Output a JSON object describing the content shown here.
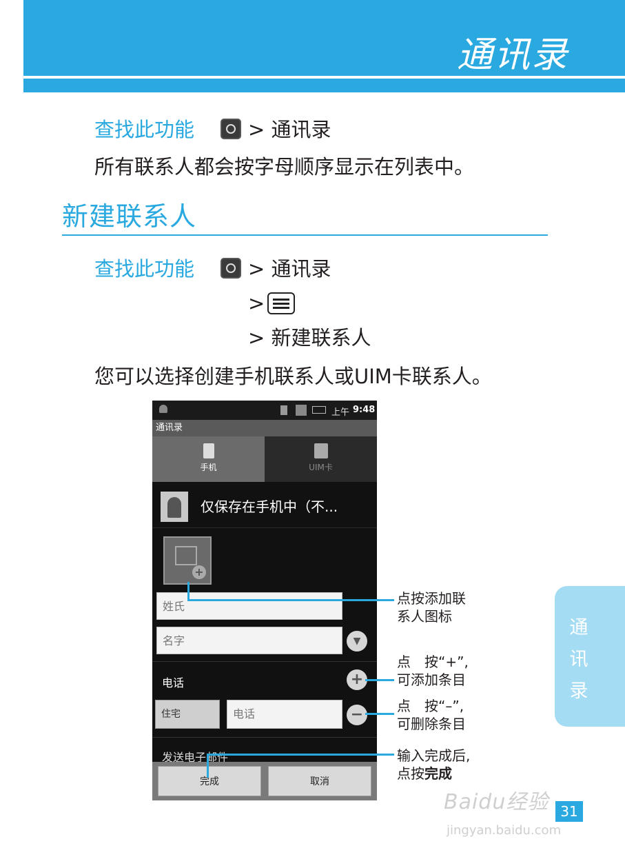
{
  "header": {
    "title": "通讯录"
  },
  "block1": {
    "find_label": "查找此功能",
    "path": "> 通讯录",
    "body": "所有联系人都会按字母顺序显示在列表中。"
  },
  "section": {
    "title": "新建联系人"
  },
  "block2": {
    "find_label": "查找此功能",
    "path1": "> 通讯录",
    "path2": ">",
    "path3": "> 新建联系人",
    "body": "您可以选择创建手机联系人或UIM卡联系人。"
  },
  "phone": {
    "status_time_prefix": "上午",
    "status_time": "9:48",
    "app_title": "通讯录",
    "tabs": [
      {
        "label": "手机"
      },
      {
        "label": "UIM卡"
      }
    ],
    "save_location": "仅保存在手机中（不...",
    "fields": {
      "surname_placeholder": "姓氏",
      "given_placeholder": "名字",
      "phone_section": "电话",
      "phone_type": "住宅",
      "phone_placeholder": "电话",
      "email_section": "发送电子邮件"
    },
    "buttons": {
      "done": "完成",
      "cancel": "取消"
    }
  },
  "callouts": {
    "photo_line1": "点按添加联",
    "photo_line2": "系人图标",
    "add_line1": "点　按“+”,",
    "add_line2": "可添加条目",
    "remove_line1": "点　按“–”,",
    "remove_line2": "可删除条目",
    "done_line1": "输入完成后,",
    "done_line2_prefix": "点按",
    "done_line2_bold": "完成"
  },
  "side_tab": {
    "label": "通讯录"
  },
  "page_number": "31",
  "watermark": {
    "brand": "Baidu经验",
    "url": "jingyan.baidu.com"
  },
  "colors": {
    "accent": "#29a9df",
    "side_tab": "#a4dcf4"
  }
}
